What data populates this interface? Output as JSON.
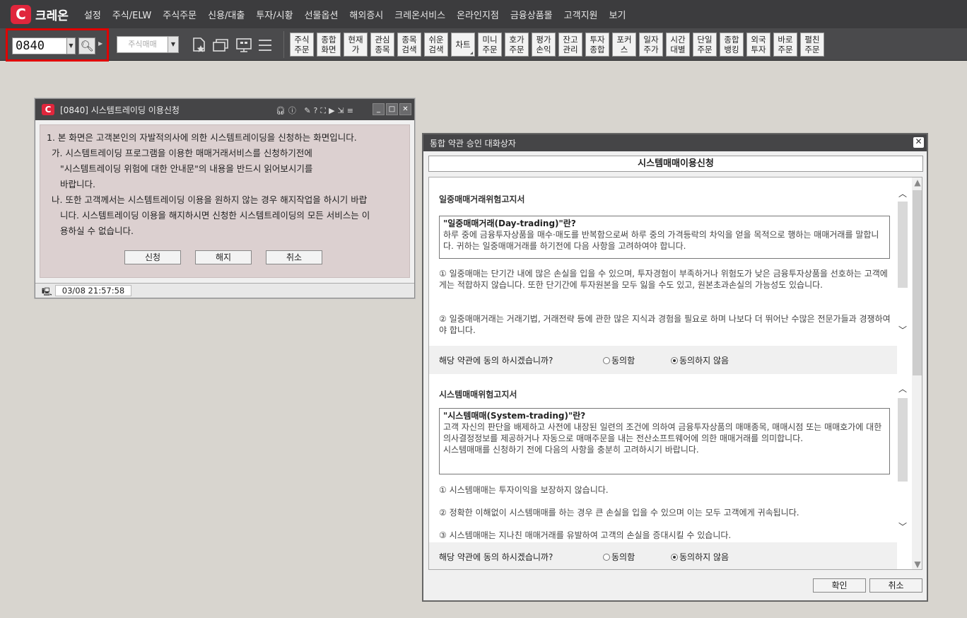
{
  "app": {
    "logo_glyph": "C",
    "brand": "크레온",
    "accent": "#e0263c"
  },
  "menu": [
    "설정",
    "주식/ELW",
    "주식주문",
    "신용/대출",
    "투자/시황",
    "선물옵션",
    "해외증시",
    "크레온서비스",
    "온라인지점",
    "금융상품몰",
    "고객지원",
    "보기"
  ],
  "toolbar": {
    "code_value": "0840",
    "screen_placeholder": "주식매매",
    "quick_buttons": [
      "주식\n주문",
      "종합\n화면",
      "현재\n가",
      "관심\n종목",
      "종목\n검색",
      "쉬운\n검색",
      "차트",
      "미니\n주문",
      "호가\n주문",
      "평가\n손익",
      "잔고\n관리",
      "투자\n종합",
      "포커\n스",
      "일자\n주가",
      "시간\n대별",
      "단일\n주문",
      "종합\n뱅킹",
      "외국\n투자",
      "바로\n주문",
      "펼친\n주문"
    ]
  },
  "win1": {
    "title": "[0840] 시스템트레이딩 이용신청",
    "lines": [
      "1. 본 화면은 고객본인의 자발적의사에 의한 시스템트레이딩을 신청하는 화면입니다.",
      "가. 시스템트레이딩 프로그램을 이용한 매매거래서비스를 신청하기전에",
      "\"시스템트레이딩 위험에 대한 안내문\"의 내용을 반드시 읽어보시기를",
      "바랍니다.",
      "나. 또한 고객께서는 시스템트레이딩 이용을 원하지 않는 경우 해지작업을 하시기 바랍",
      "니다. 시스템트레이딩 이용을 해지하시면 신청한 시스템트레이딩의 모든 서비스는 이",
      "용하실 수 없습니다."
    ],
    "buttons": {
      "apply": "신청",
      "cancel_sub": "해지",
      "close": "취소"
    },
    "status_time": "03/08 21:57:58"
  },
  "win2": {
    "title": "통합 약관 승인 대화상자",
    "heading": "시스템매매이용신청",
    "section1": {
      "title": "일중매매거래위험고지서",
      "def_title": "\"일중매매거래(Day-trading)\"란?",
      "def_body": "하루 중에 금융투자상품을 매수·매도를 반복함으로써 하루 중의 가격등락의 차익을 얻을 목적으로 행하는 매매거래를 말합니다. 귀하는 일중매매거래를 하기전에 다음 사항을 고려하여야 합니다.",
      "items": [
        "① 일중매매는 단기간 내에 많은 손실을 입을 수 있으며, 투자경험이 부족하거나 위험도가 낮은 금융투자상품을 선호하는 고객에게는 적합하지 않습니다. 또한 단기간에 투자원본을 모두 잃을 수도 있고, 원본초과손실의 가능성도 있습니다.",
        "② 일중매매거래는 거래기법, 거래전략 등에 관한 많은 지식과 경험을 필요로 하며 나보다 더 뛰어난 수많은 전문가들과 경쟁하여야 합니다."
      ]
    },
    "section2": {
      "title": "시스템매매위험고지서",
      "def_title": "\"시스템매매(System-trading)\"란?",
      "def_body": "고객 자신의 판단을 배제하고 사전에 내장된 일련의 조건에 의하여 금융투자상품의 매매종목, 매매시점 또는 매매호가에 대한 의사결정정보를 제공하거나 자동으로 매매주문을 내는 전산소프트웨어에 의한 매매거래를 의미합니다.",
      "def_body2": "시스템매매를 신청하기 전에 다음의 사항을 충분히 고려하시기 바랍니다.",
      "items": [
        "① 시스템매매는 투자이익을 보장하지 않습니다.",
        "② 정확한 이해없이 시스템매매를 하는 경우 큰 손실을 입을 수 있으며 이는 모두 고객에게 귀속됩니다.",
        "③ 시스템매매는 지나친 매매거래를 유발하여 고객의 손실을 증대시킬 수 있습니다."
      ]
    },
    "agree": {
      "question": "해당 약관에 동의 하시겠습니까?",
      "yes": "동의함",
      "no": "동의하지 않음"
    },
    "buttons": {
      "ok": "확인",
      "cancel": "취소"
    }
  }
}
